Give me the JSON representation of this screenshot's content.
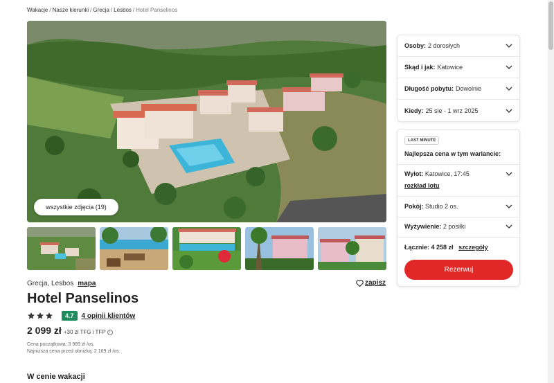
{
  "breadcrumb": {
    "items": [
      "Wakacje",
      "Nasze kierunki",
      "Grecja",
      "Lesbos"
    ],
    "current": "Hotel Panselinos"
  },
  "gallery": {
    "all_photos_label": "wszystkie zdjęcia (19)"
  },
  "hotel": {
    "location": "Grecja, Lesbos",
    "map_label": "mapa",
    "save_label": "zapisz",
    "name": "Hotel Panselinos",
    "stars": 3,
    "score": "4.7",
    "opinions_label": "4 opinii klientów"
  },
  "price": {
    "amount": "2 099 zł",
    "fee": "+30 zł TFG i TFP",
    "initial_price": "Cena początkowa: 3 989 zł /os.",
    "lowest_before_discount": "Najniższa cena przed obniżką: 2 169 zł /os."
  },
  "section": {
    "title": "W cenie wakacji"
  },
  "filters": [
    {
      "label": "Osoby:",
      "value": "2 dorosłych"
    },
    {
      "label": "Skąd i jak:",
      "value": "Katowice"
    },
    {
      "label": "Długość pobytu:",
      "value": "Dowolnie"
    },
    {
      "label": "Kiedy:",
      "value": "25 sie - 1 wrz 2025"
    }
  ],
  "offer": {
    "badge": "LAST MINUTE",
    "best_price_label": "Najlepsza cena w tym wariancie:",
    "flight_label": "Wylot:",
    "flight_value": "Katowice, 17:45",
    "flight_link": "rozkład lotu",
    "room_label": "Pokój:",
    "room_value": "Studio 2 os.",
    "board_label": "Wyżywienie:",
    "board_value": "2 posiłki",
    "total_label": "Łącznie:",
    "total_value": "4 258 zł",
    "details_link": "szczegóły",
    "book_label": "Rezerwuj"
  },
  "colors": {
    "accent": "#e22826",
    "score_bg": "#1f8a5c"
  }
}
